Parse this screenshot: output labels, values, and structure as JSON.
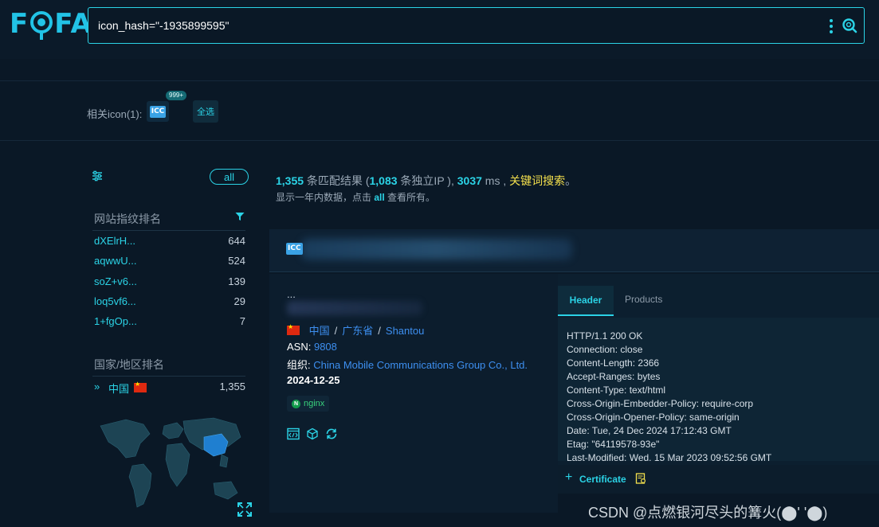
{
  "logo": {
    "text_f": "F",
    "text_fa": "FA"
  },
  "search": {
    "query": "icon_hash=\"-1935899595\""
  },
  "related_icons": {
    "label": "相关icon(1):",
    "icon_text": "ICC",
    "count_badge": "999+",
    "select_all": "全选"
  },
  "sidebar": {
    "all_label": "all",
    "fingerprint_title": "网站指纹排名",
    "fingerprints": [
      {
        "name": "dXElrH...",
        "count": "644"
      },
      {
        "name": "aqwwU...",
        "count": "524"
      },
      {
        "name": "soZ+v6...",
        "count": "139"
      },
      {
        "name": "loq5vf6...",
        "count": "29"
      },
      {
        "name": "1+fgOp...",
        "count": "7"
      }
    ],
    "country_title": "国家/地区排名",
    "countries": [
      {
        "name": "中国",
        "count": "1,355"
      }
    ]
  },
  "stats": {
    "matches": "1,355",
    "matches_label": " 条匹配结果 (",
    "unique_ip": "1,083",
    "unique_ip_label": " 条独立IP ), ",
    "time": "3037",
    "time_unit": " ms , ",
    "keyword_search": "关键词搜索",
    "end": "。",
    "sub_prefix": "显示一年内数据，点击 ",
    "sub_all": "all",
    "sub_suffix": " 查看所有。"
  },
  "result": {
    "icon_text": "ICC",
    "ellipsis": "...",
    "country": "中国",
    "province": "广东省",
    "city": "Shantou",
    "asn_label": "ASN: ",
    "asn": "9808",
    "org_label": "组织: ",
    "org": "China Mobile Communications Group Co., Ltd.",
    "date": "2024-12-25",
    "product_tag": "nginx",
    "product_tag_icon": "N"
  },
  "header_panel": {
    "tabs": [
      "Header",
      "Products"
    ],
    "lines": [
      "HTTP/1.1 200 OK",
      "Connection: close",
      "Content-Length: 2366",
      "Accept-Ranges: bytes",
      "Content-Type: text/html",
      "Cross-Origin-Embedder-Policy: require-corp",
      "Cross-Origin-Opener-Policy: same-origin",
      "Date: Tue, 24 Dec 2024 17:12:43 GMT",
      "Etag: \"64119578-93e\"",
      "Last-Modified: Wed, 15 Mar 2023 09:52:56 GMT"
    ],
    "certificate": "Certificate"
  },
  "watermark": "CSDN @点燃银河尽头的篝火(⬤' '⬤)",
  "colors": {
    "accent": "#2bd3e6",
    "link": "#3d8ff0",
    "keyword": "#f4e04d",
    "bg": "#0a1826"
  }
}
